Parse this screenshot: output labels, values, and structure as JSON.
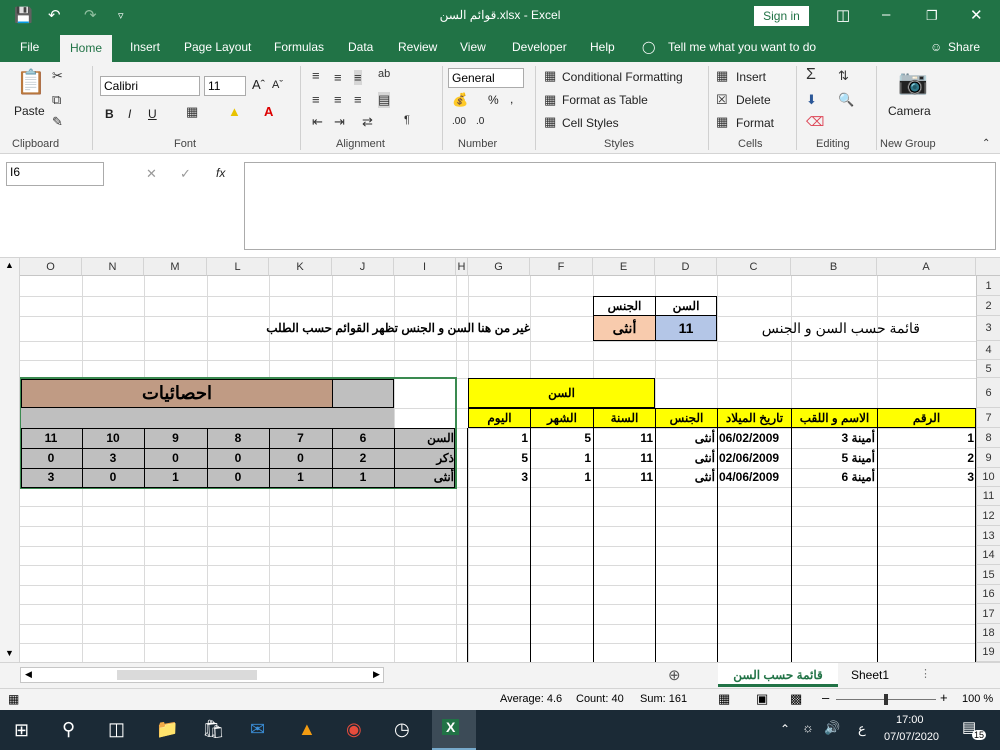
{
  "window": {
    "title": "قوائم السن.xlsx  -  Excel",
    "signin": "Sign in"
  },
  "tabs": [
    "File",
    "Home",
    "Insert",
    "Page Layout",
    "Formulas",
    "Data",
    "Review",
    "View",
    "Developer",
    "Help"
  ],
  "tell_me": "Tell me what you want to do",
  "share": "Share",
  "ribbon": {
    "paste": "Paste",
    "font_name": "Calibri",
    "font_size": "11",
    "number_format": "General",
    "conditional_formatting": "Conditional Formatting",
    "format_as_table": "Format as Table",
    "cell_styles": "Cell Styles",
    "insert": "Insert",
    "delete": "Delete",
    "format": "Format",
    "camera": "Camera",
    "groups": [
      "Clipboard",
      "Font",
      "Alignment",
      "Number",
      "Styles",
      "Cells",
      "Editing",
      "New Group"
    ],
    "bold": "B",
    "italic": "I",
    "underline": "U"
  },
  "formula_bar": {
    "name_box": "I6",
    "fx": "fx",
    "content": ""
  },
  "columns": [
    "O",
    "N",
    "M",
    "L",
    "K",
    "J",
    "I",
    "H",
    "G",
    "F",
    "E",
    "D",
    "C",
    "B",
    "A"
  ],
  "rows": [
    "1",
    "2",
    "3",
    "4",
    "5",
    "6",
    "7",
    "8",
    "9",
    "10",
    "11",
    "12",
    "13",
    "14",
    "15",
    "16",
    "17",
    "18",
    "19"
  ],
  "sheet": {
    "title": "قائمة حسب السن و الجنس",
    "age_label": "السن",
    "gender_label": "الجنس",
    "age_value": "11",
    "gender_value": "أنثى",
    "instruction": "غير من هنا السن و الجنس  تظهر القوائم حسب الطلب",
    "table_headers": [
      "الرقم",
      "الاسم و اللقب",
      "تاريخ الميلاد",
      "الجنس",
      "السنة",
      "الشهر",
      "اليوم"
    ],
    "age_group_header": "السن",
    "table_rows": [
      [
        "1",
        "أمينة 3",
        "06/02/2009",
        "أنثى",
        "11",
        "5",
        "1"
      ],
      [
        "2",
        "أمينة 5",
        "02/06/2009",
        "أنثى",
        "11",
        "1",
        "5"
      ],
      [
        "3",
        "أمينة 6",
        "04/06/2009",
        "أنثى",
        "11",
        "1",
        "3"
      ]
    ],
    "stats_title": "احصائيات",
    "stats_rows": [
      [
        "السن",
        "6",
        "7",
        "8",
        "9",
        "10",
        "11"
      ],
      [
        "ذكر",
        "2",
        "0",
        "0",
        "0",
        "3",
        "0"
      ],
      [
        "أنثى",
        "1",
        "1",
        "0",
        "1",
        "0",
        "3"
      ]
    ]
  },
  "sheet_tabs": [
    "قائمة  حسب السن",
    "Sheet1"
  ],
  "status": {
    "average": "Average: 4.6",
    "count": "Count: 40",
    "sum": "Sum: 161",
    "zoom": "100 %"
  },
  "taskbar": {
    "time": "17:00",
    "date": "07/07/2020",
    "lang": "ع",
    "notif": "15"
  },
  "colors": {
    "excel_green": "#217346",
    "yellow": "#ffff00",
    "stats_brown": "#c09b84",
    "age_blue": "#b4c6e7",
    "gender_peach": "#f8cbad"
  }
}
